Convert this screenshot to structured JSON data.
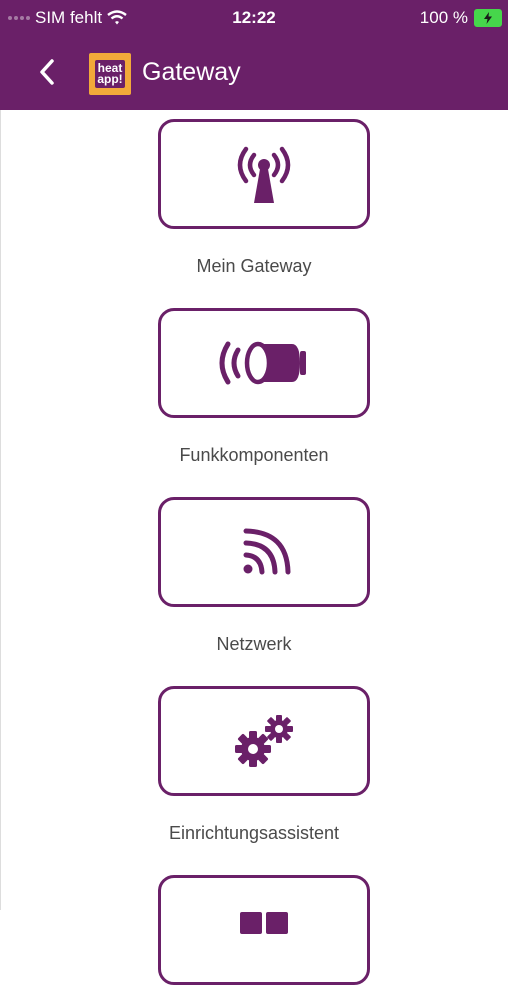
{
  "status_bar": {
    "carrier": "SIM fehlt",
    "time": "12:22",
    "battery": "100 %"
  },
  "header": {
    "title": "Gateway",
    "logo_text_top": "heat",
    "logo_text_bottom": "app!"
  },
  "menu": {
    "items": [
      {
        "label": "Mein Gateway",
        "icon": "antenna-icon"
      },
      {
        "label": "Funkkomponenten",
        "icon": "radio-valve-icon"
      },
      {
        "label": "Netzwerk",
        "icon": "network-signal-icon"
      },
      {
        "label": "Einrichtungsassistent",
        "icon": "gears-icon"
      },
      {
        "label": "",
        "icon": "grid-icon"
      }
    ]
  },
  "colors": {
    "brand": "#6a2068",
    "logo_bg": "#f2a93a",
    "battery": "#46d64b"
  }
}
